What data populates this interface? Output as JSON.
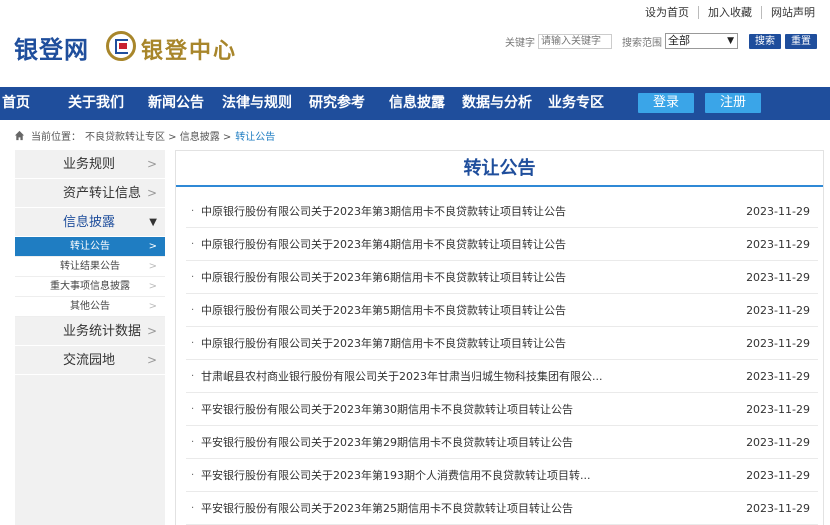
{
  "top_links": [
    "设为首页",
    "加入收藏",
    "网站声明"
  ],
  "logo": {
    "text": "银登网",
    "seal_text": "银登中心"
  },
  "search": {
    "keyword_label": "关键字",
    "keyword_placeholder": "请输入关键字",
    "scope_label": "搜索范围",
    "scope_value": "全部",
    "search_button": "搜索",
    "reset_button": "重置"
  },
  "nav": {
    "items": [
      "首页",
      "关于我们",
      "新闻公告",
      "法律与规则",
      "研究参考",
      "信息披露",
      "数据与分析",
      "业务专区"
    ],
    "login": "登录",
    "register": "注册"
  },
  "breadcrumb": {
    "label": "当前位置：",
    "path": "不良贷款转让专区 > 信息披露 >",
    "current": "转让公告"
  },
  "sidebar": {
    "sections": [
      {
        "label": "业务规则",
        "chev": ">"
      },
      {
        "label": "资产转让信息",
        "chev": ">"
      },
      {
        "label": "信息披露",
        "chev": "▼"
      }
    ],
    "subitems": [
      {
        "label": "转让公告",
        "chev": ">"
      },
      {
        "label": "转让结果公告",
        "chev": ">"
      },
      {
        "label": "重大事项信息披露",
        "chev": ">"
      },
      {
        "label": "其他公告",
        "chev": ">"
      }
    ],
    "sections_after": [
      {
        "label": "业务统计数据",
        "chev": ">"
      },
      {
        "label": "交流园地",
        "chev": ">"
      }
    ]
  },
  "content": {
    "title": "转让公告",
    "items": [
      {
        "title": "中原银行股份有限公司关于2023年第3期信用卡不良贷款转让项目转让公告",
        "date": "2023-11-29"
      },
      {
        "title": "中原银行股份有限公司关于2023年第4期信用卡不良贷款转让项目转让公告",
        "date": "2023-11-29"
      },
      {
        "title": "中原银行股份有限公司关于2023年第6期信用卡不良贷款转让项目转让公告",
        "date": "2023-11-29"
      },
      {
        "title": "中原银行股份有限公司关于2023年第5期信用卡不良贷款转让项目转让公告",
        "date": "2023-11-29"
      },
      {
        "title": "中原银行股份有限公司关于2023年第7期信用卡不良贷款转让项目转让公告",
        "date": "2023-11-29"
      },
      {
        "title": "甘肃岷县农村商业银行股份有限公司关于2023年甘肃当归城生物科技集团有限公...",
        "date": "2023-11-29"
      },
      {
        "title": "平安银行股份有限公司关于2023年第30期信用卡不良贷款转让项目转让公告",
        "date": "2023-11-29"
      },
      {
        "title": "平安银行股份有限公司关于2023年第29期信用卡不良贷款转让项目转让公告",
        "date": "2023-11-29"
      },
      {
        "title": "平安银行股份有限公司关于2023年第193期个人消费信用不良贷款转让项目转...",
        "date": "2023-11-29"
      },
      {
        "title": "平安银行股份有限公司关于2023年第25期信用卡不良贷款转让项目转让公告",
        "date": "2023-11-29"
      }
    ]
  }
}
